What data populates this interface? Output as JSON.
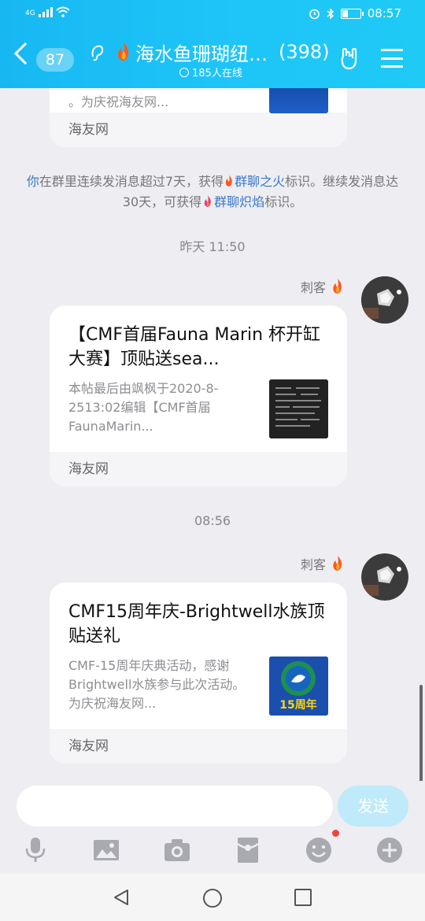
{
  "status": {
    "network": "4G",
    "time": "08:57"
  },
  "header": {
    "back_count": "87",
    "group_name": "海水鱼珊瑚纽带群",
    "member_count": "(398)",
    "online": "185人在线"
  },
  "messages": {
    "card1": {
      "desc_tail": "。为庆祝海友网...",
      "source": "海友网"
    },
    "system_notice": {
      "part1": "你",
      "part2": "在群里连续发消息超过7天，获得",
      "link1": "群聊之火",
      "part3": "标识。继续发消息达30天，可获得",
      "link2": "群聊炽焰",
      "part4": "标识。"
    },
    "stamp1": "昨天 11:50",
    "card2": {
      "sender": "刺客",
      "title": "【CMF首届Fauna Marin 杯开缸大赛】顶贴送sea...",
      "desc": "本帖最后由飒枫于2020-8-2513:02编辑【CMF首届FaunaMarin...",
      "source": "海友网"
    },
    "stamp2": "08:56",
    "card3": {
      "sender": "刺客",
      "title": "CMF15周年庆-Brightwell水族顶贴送礼",
      "desc": "CMF-15周年庆典活动，感谢Brightwell水族参与此次活动。为庆祝海友网...",
      "thumb_text": "15周年",
      "source": "海友网"
    }
  },
  "composer": {
    "placeholder": "",
    "send_label": "发送"
  },
  "toolbar": [
    "microphone-icon",
    "image-icon",
    "camera-icon",
    "red-packet-icon",
    "emoji-icon",
    "plus-icon"
  ],
  "colors": {
    "header": "#1ec5f8",
    "link": "#3a78c8",
    "send_disabled": "#bfeaf9",
    "badge_red": "#f0443a"
  }
}
